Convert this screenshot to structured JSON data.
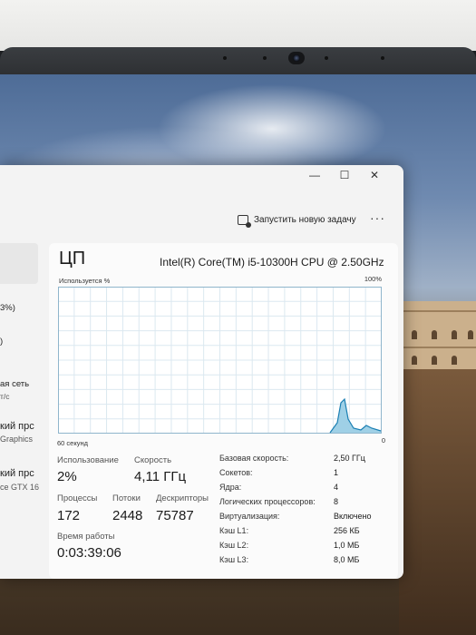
{
  "window": {
    "controls": {
      "minimize": "—",
      "maximize": "☐",
      "close": "✕"
    }
  },
  "toolbar": {
    "run_task_label": "Запустить новую задачу",
    "more_label": "···"
  },
  "sidebar": {
    "items": [
      {
        "text": "3%)"
      },
      {
        "text": ")"
      },
      {
        "text": "ая сеть",
        "sub": "т/с"
      },
      {
        "text": "кий прс",
        "sub": "Graphics"
      },
      {
        "text": "кий прс",
        "sub": "ce GTX 16"
      }
    ]
  },
  "cpu": {
    "title": "ЦП",
    "model": "Intel(R) Core(TM) i5-10300H CPU @ 2.50GHz",
    "graph": {
      "utilization_label": "Используется %",
      "max_label": "100%",
      "time_label": "60 секунд",
      "min_label": "0",
      "line_color": "#1a7fb3",
      "fill_color": "#9fd0e6"
    },
    "stats": {
      "utilization_label": "Использование",
      "utilization_value": "2%",
      "speed_label": "Скорость",
      "speed_value": "4,11 ГГц",
      "processes_label": "Процессы",
      "processes_value": "172",
      "threads_label": "Потоки",
      "threads_value": "2448",
      "handles_label": "Дескрипторы",
      "handles_value": "75787",
      "uptime_label": "Время работы",
      "uptime_value": "0:03:39:06"
    },
    "details": [
      {
        "label": "Базовая скорость:",
        "value": "2,50 ГГц"
      },
      {
        "label": "Сокетов:",
        "value": "1"
      },
      {
        "label": "Ядра:",
        "value": "4"
      },
      {
        "label": "Логических процессоров:",
        "value": "8"
      },
      {
        "label": "Виртуализация:",
        "value": "Включено"
      },
      {
        "label": "Кэш L1:",
        "value": "256 КБ"
      },
      {
        "label": "Кэш L2:",
        "value": "1,0 МБ"
      },
      {
        "label": "Кэш L3:",
        "value": "8,0 МБ"
      }
    ]
  }
}
